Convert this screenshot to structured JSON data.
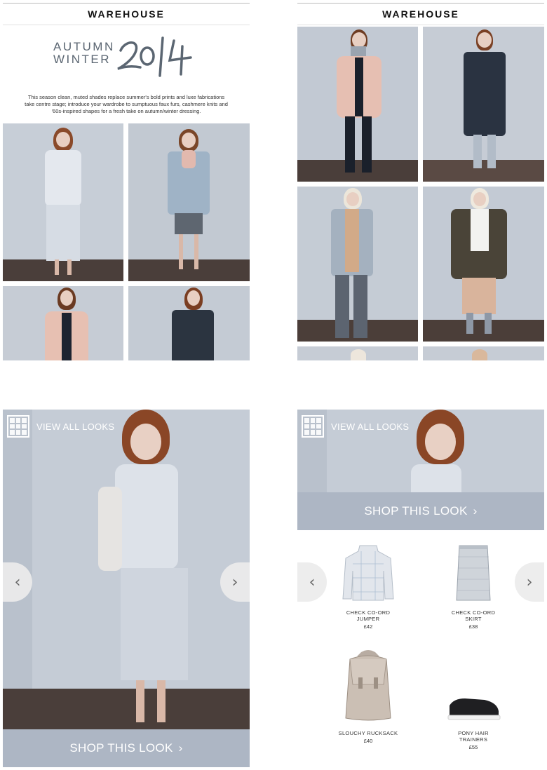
{
  "brand": "WAREHOUSE",
  "hero": {
    "season_line1": "AUTUMN",
    "season_line2": "WINTER",
    "year": "2014",
    "intro": "This season clean, muted shades replace summer's bold prints and luxe fabrications take centre stage; introduce your wardrobe to sumptuous faux furs, cashmere knits and '60s-inspired shapes for a fresh take on autumn/winter dressing."
  },
  "look_view": {
    "view_all_label": "VIEW ALL LOOKS",
    "shop_label": "SHOP THIS LOOK",
    "shop_chevron": "›",
    "prev_icon": "‹",
    "next_icon": "›"
  },
  "products": [
    {
      "name_line1": "CHECK CO-ORD",
      "name_line2": "JUMPER",
      "price": "£42"
    },
    {
      "name_line1": "CHECK CO-ORD",
      "name_line2": "SKIRT",
      "price": "£38"
    },
    {
      "name_line1": "SLOUCHY RUCKSACK",
      "name_line2": "",
      "price": "£40"
    },
    {
      "name_line1": "PONY HAIR",
      "name_line2": "TRAINERS",
      "price": "£55"
    }
  ],
  "colors": {
    "wall": "#c3cad4",
    "floor": "#4a3e3a",
    "shop_bar": "#adb6c4",
    "text_dark": "#111111",
    "heading_grey": "#5b6672"
  }
}
